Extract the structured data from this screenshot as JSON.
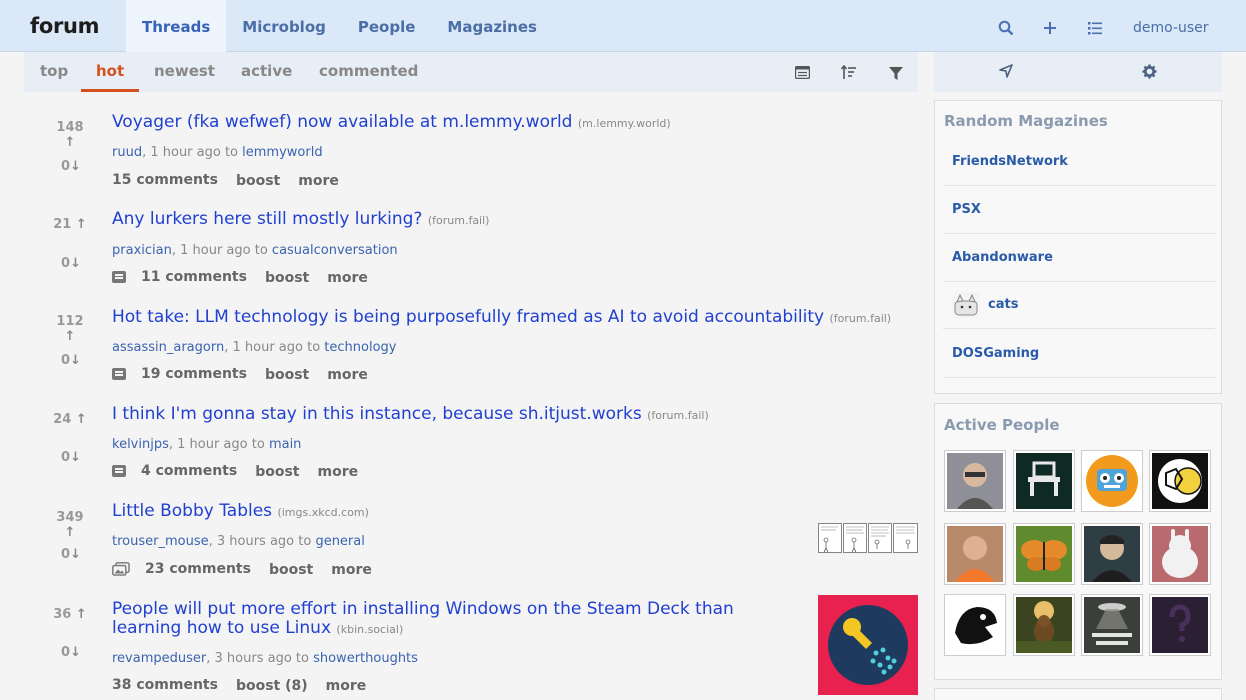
{
  "header": {
    "logo": "forum",
    "nav": [
      "Threads",
      "Microblog",
      "People",
      "Magazines"
    ],
    "user": "demo-user"
  },
  "sort": {
    "tabs": [
      "top",
      "hot",
      "newest",
      "active",
      "commented"
    ],
    "active": "hot"
  },
  "posts": [
    {
      "up": "148",
      "down": "0",
      "title": "Voyager (fka wefwef) now available at m.lemmy.world",
      "domain": "(m.lemmy.world)",
      "author": "ruud",
      "time": ", 1 hour ago to ",
      "mag": "lemmyworld",
      "comments": "15 comments",
      "boost": "boost",
      "more": "more",
      "icon": false
    },
    {
      "up": "21",
      "down": "0",
      "title": "Any lurkers here still mostly lurking?",
      "domain": "(forum.fail)",
      "author": "praxician",
      "time": ", 1 hour ago to ",
      "mag": "casualconversation",
      "comments": "11 comments",
      "boost": "boost",
      "more": "more",
      "icon": true
    },
    {
      "up": "112",
      "down": "0",
      "title": "Hot take: LLM technology is being purposefully framed as AI to avoid accountability",
      "domain": "(forum.fail)",
      "author": "assassin_aragorn",
      "time": ", 1 hour ago to ",
      "mag": "technology",
      "comments": "19 comments",
      "boost": "boost",
      "more": "more",
      "icon": true
    },
    {
      "up": "24",
      "down": "0",
      "title": "I think I'm gonna stay in this instance, because sh.itjust.works",
      "domain": "(forum.fail)",
      "author": "kelvinjps",
      "time": ", 1 hour ago to ",
      "mag": "main",
      "comments": "4 comments",
      "boost": "boost",
      "more": "more",
      "icon": true
    },
    {
      "up": "349",
      "down": "0",
      "title": "Little Bobby Tables",
      "domain": "(imgs.xkcd.com)",
      "author": "trouser_mouse",
      "time": ", 3 hours ago to ",
      "mag": "general",
      "comments": "23 comments",
      "boost": "boost",
      "more": "more",
      "icon": true
    },
    {
      "up": "36",
      "down": "0",
      "title": "People will put more effort in installing Windows on the Steam Deck than learning how to use Linux",
      "domain": "(kbin.social)",
      "author": "revampeduser",
      "time": ", 3 hours ago to ",
      "mag": "showerthoughts",
      "comments": "38 comments",
      "boost": "boost (8)",
      "more": "more",
      "icon": false
    }
  ],
  "sidebar": {
    "random_title": "Random Magazines",
    "magazines": [
      "FriendsNetwork",
      "PSX",
      "Abandonware",
      "cats",
      "DOSGaming"
    ],
    "people_title": "Active People"
  }
}
